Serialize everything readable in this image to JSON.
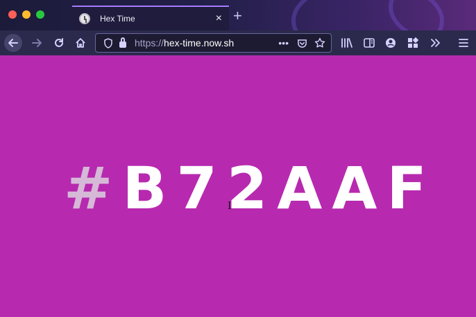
{
  "window": {
    "controls": [
      "close",
      "minimize",
      "maximize"
    ],
    "colors": {
      "close": "#fe5f57",
      "minimize": "#febc2e",
      "maximize": "#28c840"
    }
  },
  "tab": {
    "title": "Hex Time",
    "favicon": "clock-icon",
    "close_label": "×"
  },
  "new_tab_label": "+",
  "toolbar": {
    "back_icon": "arrow-left-icon",
    "forward_icon": "arrow-right-icon",
    "reload_icon": "reload-icon",
    "home_icon": "home-icon",
    "right_icons": [
      "library-icon",
      "sidebar-icon",
      "account-icon",
      "extensions-icon",
      "overflow-chevron-icon",
      "hamburger-menu-icon"
    ]
  },
  "urlbar": {
    "scheme": "https://",
    "host": "hex-time.now.sh",
    "page_actions": "•••",
    "icons": [
      "shield-icon",
      "lock-icon",
      "pocket-icon",
      "star-icon"
    ]
  },
  "page": {
    "hash": "#",
    "hex_value": "B72AAF",
    "background_color": "#b72aaf"
  }
}
